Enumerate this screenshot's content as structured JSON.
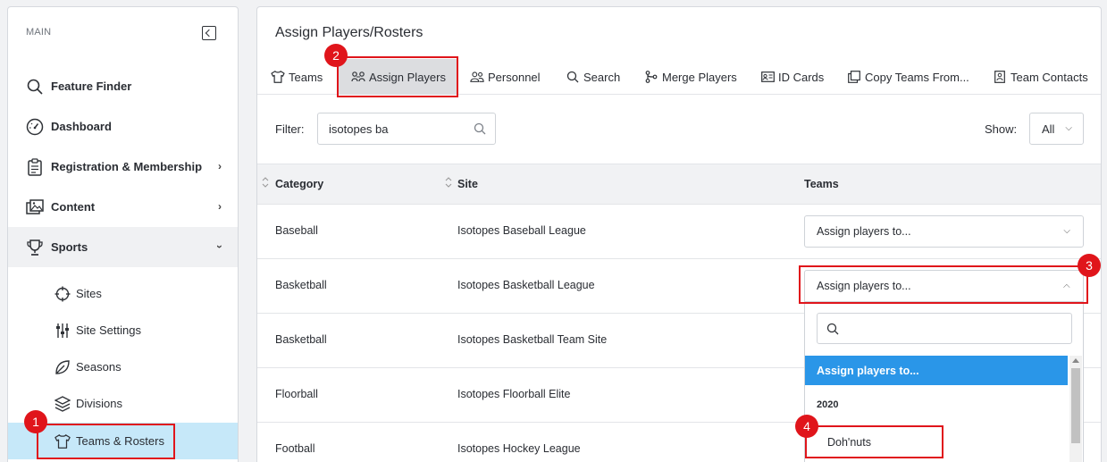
{
  "sidebar": {
    "section_label": "MAIN",
    "items": [
      {
        "label": "Feature Finder",
        "icon": "search-icon"
      },
      {
        "label": "Dashboard",
        "icon": "speedometer-icon"
      },
      {
        "label": "Registration & Membership",
        "icon": "clipboard-icon"
      },
      {
        "label": "Content",
        "icon": "image-gallery-icon"
      },
      {
        "label": "Sports",
        "icon": "trophy-icon"
      }
    ],
    "sports_sub": [
      {
        "label": "Sites",
        "icon": "crosshair-icon"
      },
      {
        "label": "Site Settings",
        "icon": "sliders-icon"
      },
      {
        "label": "Seasons",
        "icon": "leaf-icon"
      },
      {
        "label": "Divisions",
        "icon": "layers-icon"
      },
      {
        "label": "Teams & Rosters",
        "icon": "jersey-icon"
      }
    ]
  },
  "main": {
    "title": "Assign Players/Rosters",
    "tabs": [
      {
        "label": "Teams",
        "icon": "jersey-icon"
      },
      {
        "label": "Assign Players",
        "icon": "assign-players-icon"
      },
      {
        "label": "Personnel",
        "icon": "people-icon"
      },
      {
        "label": "Search",
        "icon": "search-icon"
      },
      {
        "label": "Merge Players",
        "icon": "merge-icon"
      },
      {
        "label": "ID Cards",
        "icon": "id-card-icon"
      },
      {
        "label": "Copy Teams From...",
        "icon": "copy-icon"
      },
      {
        "label": "Team Contacts",
        "icon": "contact-icon"
      }
    ],
    "filter_label": "Filter:",
    "filter_value": "isotopes ba",
    "show_label": "Show:",
    "show_value": "All",
    "table": {
      "headers": {
        "category": "Category",
        "site": "Site",
        "teams": "Teams"
      },
      "rows": [
        {
          "category": "Baseball",
          "site": "Isotopes Baseball League",
          "teams": "Assign players to..."
        },
        {
          "category": "Basketball",
          "site": "Isotopes Basketball League",
          "teams": "Assign players to..."
        },
        {
          "category": "Basketball",
          "site": "Isotopes Basketball Team Site",
          "teams": ""
        },
        {
          "category": "Floorball",
          "site": "Isotopes Floorball Elite",
          "teams": ""
        },
        {
          "category": "Football",
          "site": "Isotopes Hockey League",
          "teams": ""
        }
      ]
    },
    "dropdown": {
      "selected_option": "Assign players to...",
      "group_label": "2020",
      "option": "Doh'nuts"
    }
  },
  "callouts": [
    "1",
    "2",
    "3",
    "4"
  ],
  "colors": {
    "highlight_red": "#e0151b",
    "active_blue": "#c6e8f9",
    "selected_option_blue": "#2a96e8"
  }
}
